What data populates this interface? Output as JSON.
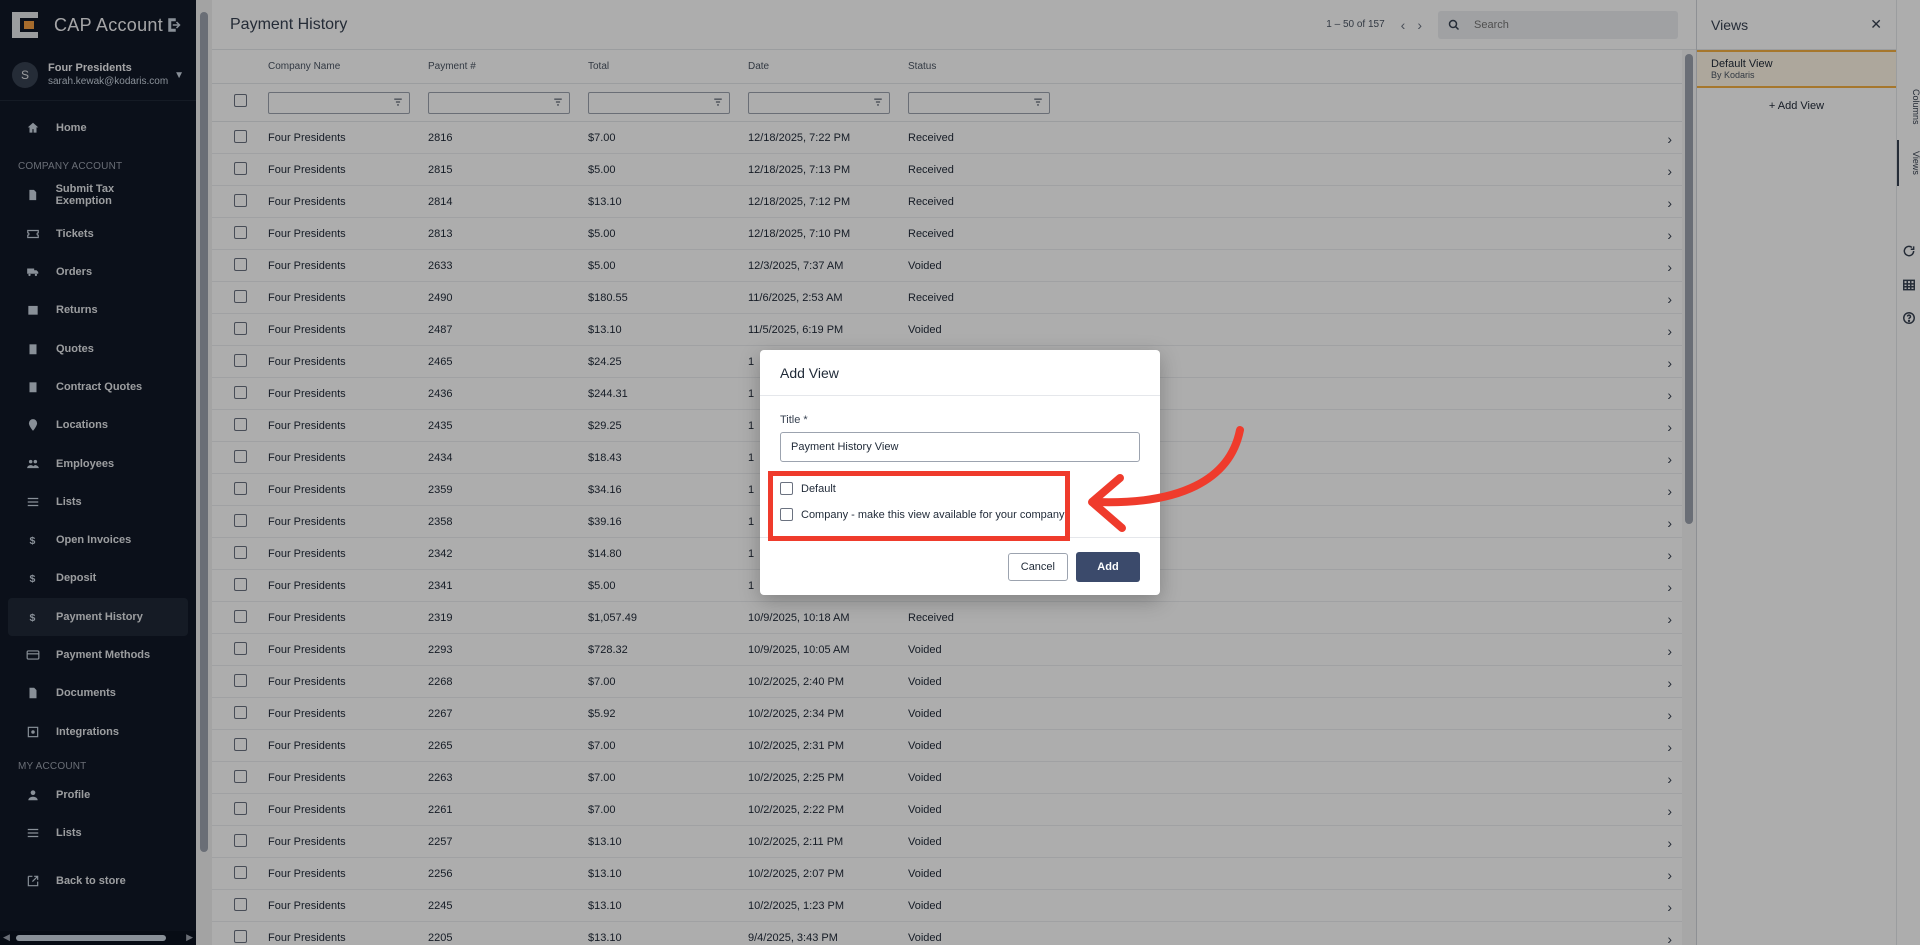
{
  "sidebar": {
    "app_title": "CAP Account",
    "user": {
      "initial": "S",
      "name": "Four Presidents",
      "email": "sarah.kewak@kodaris.com"
    },
    "home": "Home",
    "section_company": "COMPANY ACCOUNT",
    "company_items": [
      {
        "label": "Submit Tax Exemption",
        "icon": "document-icon"
      },
      {
        "label": "Tickets",
        "icon": "ticket-icon"
      },
      {
        "label": "Orders",
        "icon": "truck-icon"
      },
      {
        "label": "Returns",
        "icon": "return-box-icon"
      },
      {
        "label": "Quotes",
        "icon": "clipboard-icon"
      },
      {
        "label": "Contract Quotes",
        "icon": "clipboard-icon"
      },
      {
        "label": "Locations",
        "icon": "location-pin-icon"
      },
      {
        "label": "Employees",
        "icon": "people-icon"
      },
      {
        "label": "Lists",
        "icon": "list-icon"
      },
      {
        "label": "Open Invoices",
        "icon": "dollar-icon"
      },
      {
        "label": "Deposit",
        "icon": "dollar-icon"
      },
      {
        "label": "Payment History",
        "icon": "dollar-icon"
      },
      {
        "label": "Payment Methods",
        "icon": "credit-card-icon"
      },
      {
        "label": "Documents",
        "icon": "document-icon"
      },
      {
        "label": "Integrations",
        "icon": "integration-icon"
      }
    ],
    "section_my": "MY ACCOUNT",
    "my_items": [
      {
        "label": "Profile",
        "icon": "person-icon"
      },
      {
        "label": "Lists",
        "icon": "list-icon"
      }
    ],
    "back": "Back to store"
  },
  "main": {
    "title": "Payment History",
    "pager": "1 – 50 of 157",
    "search_placeholder": "Search",
    "columns": [
      "Company Name",
      "Payment #",
      "Total",
      "Date",
      "Status"
    ],
    "rows": [
      [
        "Four Presidents",
        "2816",
        "$7.00",
        "12/18/2025, 7:22 PM",
        "Received"
      ],
      [
        "Four Presidents",
        "2815",
        "$5.00",
        "12/18/2025, 7:13 PM",
        "Received"
      ],
      [
        "Four Presidents",
        "2814",
        "$13.10",
        "12/18/2025, 7:12 PM",
        "Received"
      ],
      [
        "Four Presidents",
        "2813",
        "$5.00",
        "12/18/2025, 7:10 PM",
        "Received"
      ],
      [
        "Four Presidents",
        "2633",
        "$5.00",
        "12/3/2025, 7:37 AM",
        "Voided"
      ],
      [
        "Four Presidents",
        "2490",
        "$180.55",
        "11/6/2025, 2:53 AM",
        "Received"
      ],
      [
        "Four Presidents",
        "2487",
        "$13.10",
        "11/5/2025, 6:19 PM",
        "Voided"
      ],
      [
        "Four Presidents",
        "2465",
        "$24.25",
        "1",
        ""
      ],
      [
        "Four Presidents",
        "2436",
        "$244.31",
        "1",
        ""
      ],
      [
        "Four Presidents",
        "2435",
        "$29.25",
        "1",
        ""
      ],
      [
        "Four Presidents",
        "2434",
        "$18.43",
        "1",
        ""
      ],
      [
        "Four Presidents",
        "2359",
        "$34.16",
        "1",
        ""
      ],
      [
        "Four Presidents",
        "2358",
        "$39.16",
        "1",
        ""
      ],
      [
        "Four Presidents",
        "2342",
        "$14.80",
        "1",
        ""
      ],
      [
        "Four Presidents",
        "2341",
        "$5.00",
        "1",
        ""
      ],
      [
        "Four Presidents",
        "2319",
        "$1,057.49",
        "10/9/2025, 10:18 AM",
        "Received"
      ],
      [
        "Four Presidents",
        "2293",
        "$728.32",
        "10/9/2025, 10:05 AM",
        "Voided"
      ],
      [
        "Four Presidents",
        "2268",
        "$7.00",
        "10/2/2025, 2:40 PM",
        "Voided"
      ],
      [
        "Four Presidents",
        "2267",
        "$5.92",
        "10/2/2025, 2:34 PM",
        "Voided"
      ],
      [
        "Four Presidents",
        "2265",
        "$7.00",
        "10/2/2025, 2:31 PM",
        "Voided"
      ],
      [
        "Four Presidents",
        "2263",
        "$7.00",
        "10/2/2025, 2:25 PM",
        "Voided"
      ],
      [
        "Four Presidents",
        "2261",
        "$7.00",
        "10/2/2025, 2:22 PM",
        "Voided"
      ],
      [
        "Four Presidents",
        "2257",
        "$13.10",
        "10/2/2025, 2:11 PM",
        "Voided"
      ],
      [
        "Four Presidents",
        "2256",
        "$13.10",
        "10/2/2025, 2:07 PM",
        "Voided"
      ],
      [
        "Four Presidents",
        "2245",
        "$13.10",
        "10/2/2025, 1:23 PM",
        "Voided"
      ],
      [
        "Four Presidents",
        "2205",
        "$13.10",
        "9/4/2025, 3:43 PM",
        "Voided"
      ]
    ]
  },
  "views_panel": {
    "title": "Views",
    "default_view_name": "Default View",
    "default_view_by": "By Kodaris",
    "add_view": "+ Add View",
    "side_tabs": [
      "Columns",
      "Views"
    ]
  },
  "modal": {
    "title": "Add View",
    "field_label": "Title *",
    "title_value": "Payment History View",
    "checkbox_default": "Default",
    "checkbox_company": "Company - make this view available for your company",
    "cancel": "Cancel",
    "add": "Add"
  },
  "colors": {
    "sidebar_bg": "#111827",
    "primary_button": "#3b4a6b",
    "annotation_red": "#ef3b2c",
    "active_view_border": "#f5b041"
  }
}
